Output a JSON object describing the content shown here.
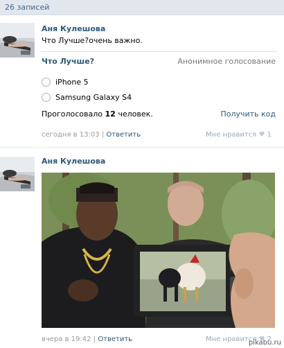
{
  "header": {
    "count": "26 записей"
  },
  "posts": [
    {
      "author": "Аня Кулешова",
      "text": "Что Лучше?очень важно.",
      "poll": {
        "title": "Что Лучше?",
        "type": "Анонимное голосование",
        "options": [
          "iPhone 5",
          "Samsung Galaxy S4"
        ],
        "votes_prefix": "Проголосовало",
        "votes_count": "12",
        "votes_suffix": "человек.",
        "code_link": "Получить код"
      },
      "date": "сегодня в 13:03",
      "separator": "|",
      "reply": "Ответить",
      "like_label": "Мне нравится",
      "like_count": "1"
    },
    {
      "author": "Аня Кулешова",
      "date": "вчера в 19:42",
      "separator": "|",
      "reply": "Ответить",
      "like_label": "Мне нравится",
      "like_count": "2"
    }
  ],
  "watermark": "pikabu.ru",
  "colors": {
    "link": "#2b587a",
    "header_bg": "#e1e7ed",
    "meta": "#999999"
  }
}
